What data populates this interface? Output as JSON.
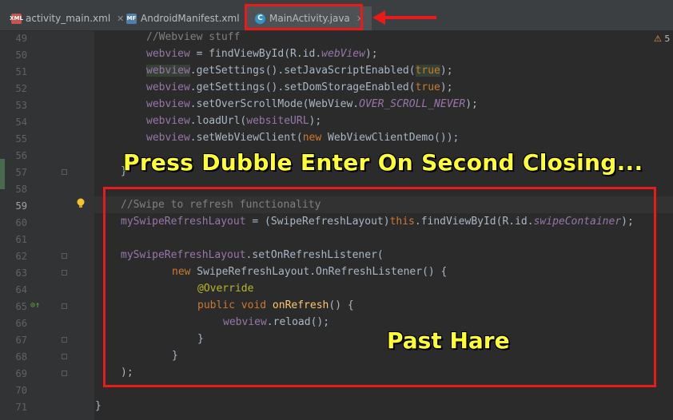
{
  "tabs": [
    {
      "label": "activity_main.xml",
      "icon": "xml-file-icon",
      "active": false
    },
    {
      "label": "AndroidManifest.xml",
      "icon": "manifest-file-icon",
      "active": false
    },
    {
      "label": "MainActivity.java",
      "icon": "java-class-icon",
      "active": true
    }
  ],
  "warning_count": "5",
  "overlay": {
    "top_text": "Press Dubble Enter On Second Closing...",
    "bottom_text": "Past Hare"
  },
  "gutter": {
    "line_numbers": [
      "49",
      "50",
      "51",
      "52",
      "53",
      "54",
      "55",
      "56",
      "57",
      "58",
      "59",
      "60",
      "61",
      "62",
      "63",
      "64",
      "65",
      "66",
      "67",
      "68",
      "69",
      "70",
      "71"
    ],
    "current_line": "59"
  },
  "colors": {
    "editor_bg": "#2b2b2b",
    "annotation_red": "#e81a1a",
    "overlay_yellow": "#ffff33"
  },
  "code_lines": [
    "//Webview stuff",
    "webview = findViewById(R.id.webView);",
    "webview.getSettings().setJavaScriptEnabled(true);",
    "webview.getSettings().setDomStorageEnabled(true);",
    "webview.setOverScrollMode(WebView.OVER_SCROLL_NEVER);",
    "webview.loadUrl(websiteURL);",
    "webview.setWebViewClient(new WebViewClientDemo());",
    "",
    "}",
    "",
    "//Swipe to refresh functionality",
    "mySwipeRefreshLayout = (SwipeRefreshLayout)this.findViewById(R.id.swipeContainer);",
    "",
    "mySwipeRefreshLayout.setOnRefreshListener(",
    "new SwipeRefreshLayout.OnRefreshListener() {",
    "@Override",
    "public void onRefresh() {",
    "webview.reload();",
    "}",
    "}",
    ");",
    "",
    "}"
  ]
}
